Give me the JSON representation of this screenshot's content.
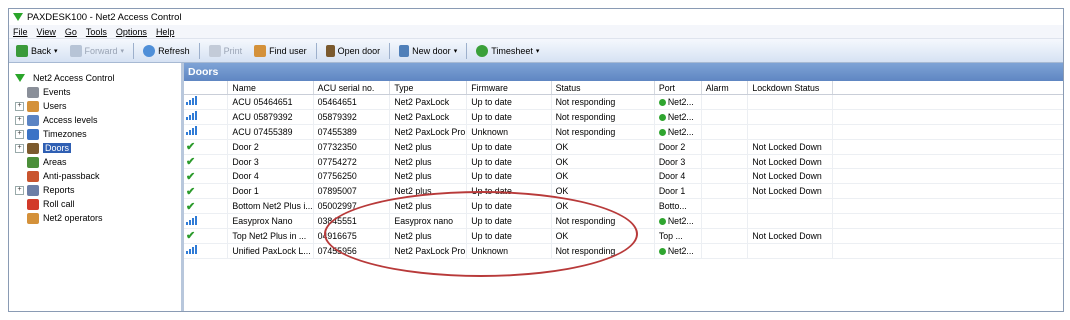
{
  "window": {
    "title": "PAXDESK100 - Net2 Access Control"
  },
  "menu": [
    "File",
    "View",
    "Go",
    "Tools",
    "Options",
    "Help"
  ],
  "toolbar": {
    "back": "Back",
    "forward": "Forward",
    "refresh": "Refresh",
    "print": "Print",
    "find_user": "Find user",
    "open_door": "Open door",
    "new_door": "New door",
    "timesheet": "Timesheet"
  },
  "tree": {
    "root": "Net2 Access Control",
    "items": [
      {
        "label": "Events",
        "icon": "events-icon",
        "expander": false,
        "color": "#8a8f99"
      },
      {
        "label": "Users",
        "icon": "users-icon",
        "expander": true,
        "color": "#d4913a"
      },
      {
        "label": "Access levels",
        "icon": "access-levels-icon",
        "expander": true,
        "color": "#5b84c4"
      },
      {
        "label": "Timezones",
        "icon": "timezones-icon",
        "expander": true,
        "color": "#3b73c6"
      },
      {
        "label": "Doors",
        "icon": "doors-icon",
        "expander": true,
        "color": "#7b5a2e"
      },
      {
        "label": "Areas",
        "icon": "areas-icon",
        "expander": false,
        "color": "#4c8f3a"
      },
      {
        "label": "Anti-passback",
        "icon": "anti-passback-icon",
        "expander": false,
        "color": "#c9542e"
      },
      {
        "label": "Reports",
        "icon": "reports-icon",
        "expander": true,
        "color": "#6c7ea6"
      },
      {
        "label": "Roll call",
        "icon": "roll-call-icon",
        "expander": false,
        "color": "#d23a2a"
      },
      {
        "label": "Net2 operators",
        "icon": "net2-operators-icon",
        "expander": false,
        "color": "#d4913a"
      }
    ],
    "selected": "Doors"
  },
  "pane": {
    "title": "Doors"
  },
  "columns": [
    "",
    "Name",
    "ACU serial no.",
    "Type",
    "Firmware",
    "Status",
    "Port",
    "Alarm",
    "Lockdown Status"
  ],
  "rows": [
    {
      "icon": "signal",
      "name": "ACU 05464651",
      "acu": "05464651",
      "type": "Net2 PaxLock",
      "fw": "Up to date",
      "status": "Not responding",
      "port": "Net2...",
      "port_dot": true,
      "alarm": "",
      "lock": ""
    },
    {
      "icon": "signal",
      "name": "ACU 05879392",
      "acu": "05879392",
      "type": "Net2 PaxLock",
      "fw": "Up to date",
      "status": "Not responding",
      "port": "Net2...",
      "port_dot": true,
      "alarm": "",
      "lock": ""
    },
    {
      "icon": "signal",
      "name": "ACU 07455389",
      "acu": "07455389",
      "type": "Net2 PaxLock Pro",
      "fw": "Unknown",
      "status": "Not responding",
      "port": "Net2...",
      "port_dot": true,
      "alarm": "",
      "lock": ""
    },
    {
      "icon": "check",
      "name": "Door 2",
      "acu": "07732350",
      "type": "Net2 plus",
      "fw": "Up to date",
      "status": "OK",
      "port": "Door 2",
      "port_dot": false,
      "alarm": "",
      "lock": "Not Locked Down"
    },
    {
      "icon": "check",
      "name": "Door 3",
      "acu": "07754272",
      "type": "Net2 plus",
      "fw": "Up to date",
      "status": "OK",
      "port": "Door 3",
      "port_dot": false,
      "alarm": "",
      "lock": "Not Locked Down"
    },
    {
      "icon": "check",
      "name": "Door 4",
      "acu": "07756250",
      "type": "Net2 plus",
      "fw": "Up to date",
      "status": "OK",
      "port": "Door 4",
      "port_dot": false,
      "alarm": "",
      "lock": "Not Locked Down"
    },
    {
      "icon": "check",
      "name": "Door 1",
      "acu": "07895007",
      "type": "Net2 plus",
      "fw": "Up to date",
      "status": "OK",
      "port": "Door 1",
      "port_dot": false,
      "alarm": "",
      "lock": "Not Locked Down"
    },
    {
      "icon": "check",
      "name": "Bottom Net2 Plus i...",
      "acu": "05002997",
      "type": "Net2 plus",
      "fw": "Up to date",
      "status": "OK",
      "port": "Botto...",
      "port_dot": false,
      "alarm": "",
      "lock": ""
    },
    {
      "icon": "signal",
      "name": "Easyprox Nano",
      "acu": "03845551",
      "type": "Easyprox nano",
      "fw": "Up to date",
      "status": "Not responding",
      "port": "Net2...",
      "port_dot": true,
      "alarm": "",
      "lock": ""
    },
    {
      "icon": "check",
      "name": "Top Net2 Plus in ...",
      "acu": "04916675",
      "type": "Net2 plus",
      "fw": "Up to date",
      "status": "OK",
      "port": "Top ...",
      "port_dot": false,
      "alarm": "",
      "lock": "Not Locked Down"
    },
    {
      "icon": "signal",
      "name": "Unified PaxLock L...",
      "acu": "07455956",
      "type": "Net2 PaxLock Pro",
      "fw": "Unknown",
      "status": "Not responding",
      "port": "Net2...",
      "port_dot": true,
      "alarm": "",
      "lock": ""
    }
  ]
}
